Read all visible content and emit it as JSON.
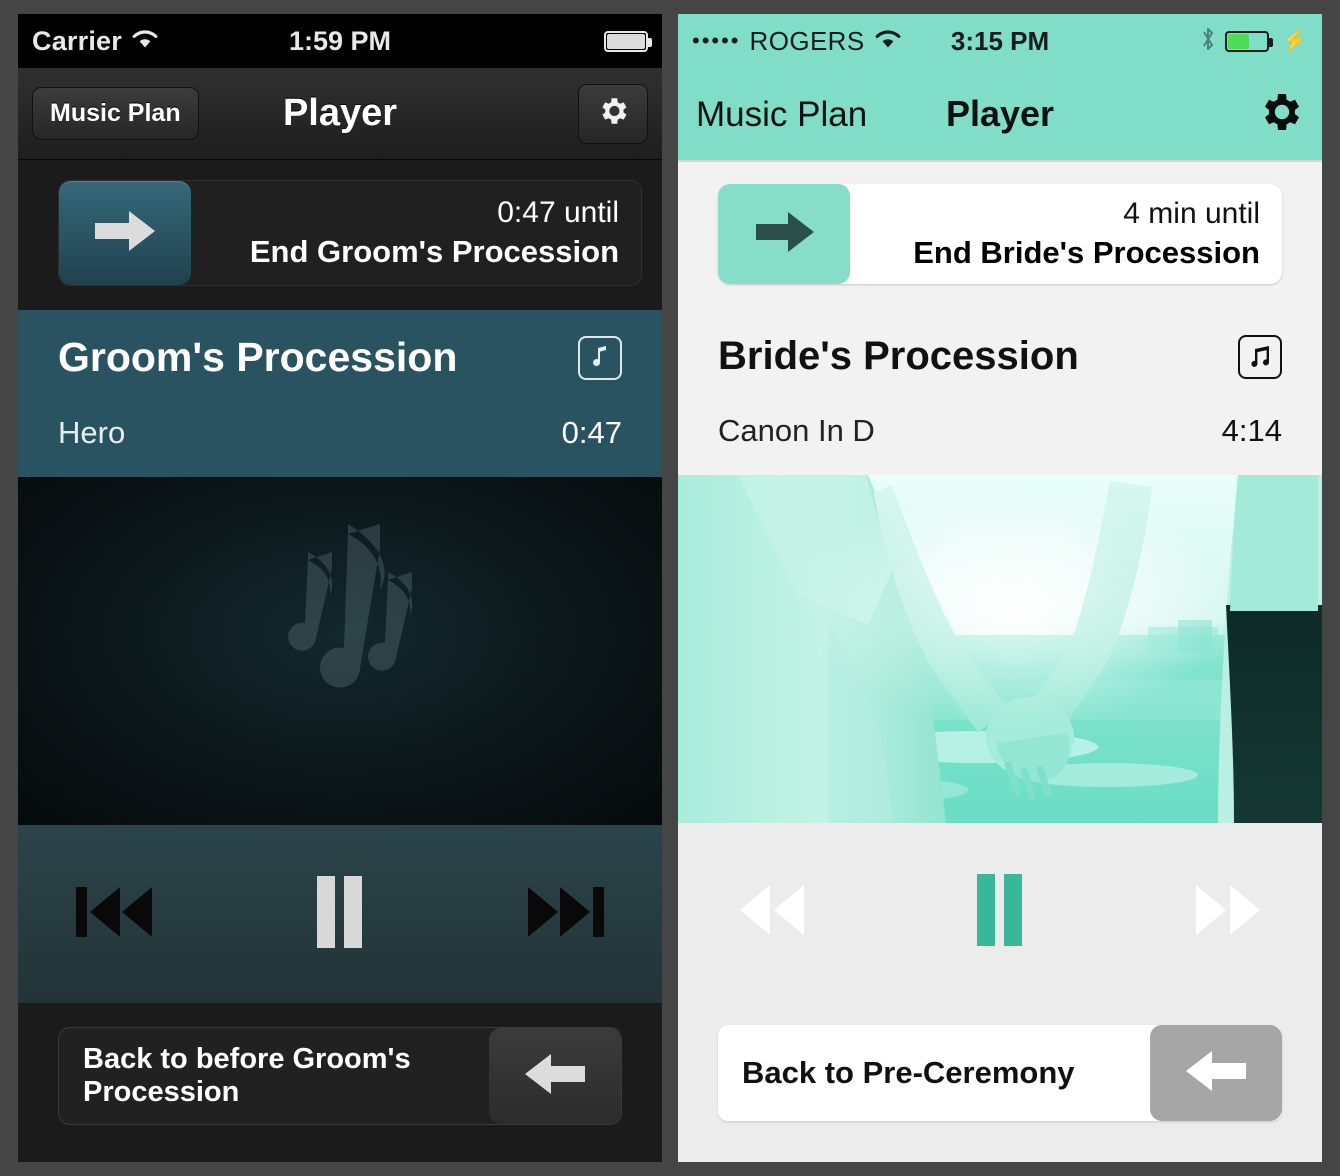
{
  "theme_colors": {
    "page_background": "#454545",
    "dark_phone_background": "#1b1b1b",
    "light_phone_background": "#ececec",
    "teal_accent": "#7fddc8",
    "teal_pause": "#38b79b",
    "dark_track_band": "#2a5361",
    "arrow_tile_dark": "#2b5764",
    "arrow_tile_light": "#86ddc8",
    "battery_green": "#4ddb5a",
    "back_tile_light": "#a6a6a6"
  },
  "dark_phone": {
    "status_bar": {
      "carrier": "Carrier",
      "wifi_icon": "wifi-icon",
      "time": "1:59 PM",
      "battery_icon": "battery-full-icon"
    },
    "nav_bar": {
      "back_label": "Music Plan",
      "title": "Player",
      "settings_icon": "gear-icon"
    },
    "countdown": {
      "arrow_icon": "arrow-right-icon",
      "time_remaining": "0:47 until",
      "event_label": "End Groom's Procession"
    },
    "track": {
      "title": "Groom's Procession",
      "note_icon": "music-note-icon",
      "artist": "Hero",
      "duration": "0:47"
    },
    "artwork": {
      "placeholder_icon": "music-notes-placeholder-icon"
    },
    "transport": {
      "previous_icon": "skip-previous-icon",
      "pause_icon": "pause-icon",
      "next_icon": "skip-next-icon"
    },
    "bottom": {
      "back_label": "Back to before Groom's Procession",
      "back_icon": "arrow-left-icon"
    }
  },
  "light_phone": {
    "status_bar": {
      "signal_dots": "•••••",
      "carrier": "ROGERS",
      "wifi_icon": "wifi-icon",
      "time": "3:15 PM",
      "bluetooth_icon": "bluetooth-icon",
      "battery_icon": "battery-charging-icon",
      "charging_icon": "lightning-bolt-icon"
    },
    "nav_bar": {
      "back_label": "Music Plan",
      "title": "Player",
      "settings_icon": "gear-icon"
    },
    "countdown": {
      "arrow_icon": "arrow-right-icon",
      "time_remaining": "4 min until",
      "event_label": "End Bride's Procession"
    },
    "track": {
      "title": "Bride's Procession",
      "note_icon": "music-notes-icon",
      "artist": "Canon In D",
      "duration": "4:14"
    },
    "artwork": {
      "photo_description": "couple-holding-hands-photo"
    },
    "transport": {
      "previous_icon": "rewind-icon",
      "pause_icon": "pause-icon",
      "next_icon": "fast-forward-icon"
    },
    "bottom": {
      "back_label": "Back to Pre-Ceremony",
      "back_icon": "arrow-left-icon"
    }
  }
}
